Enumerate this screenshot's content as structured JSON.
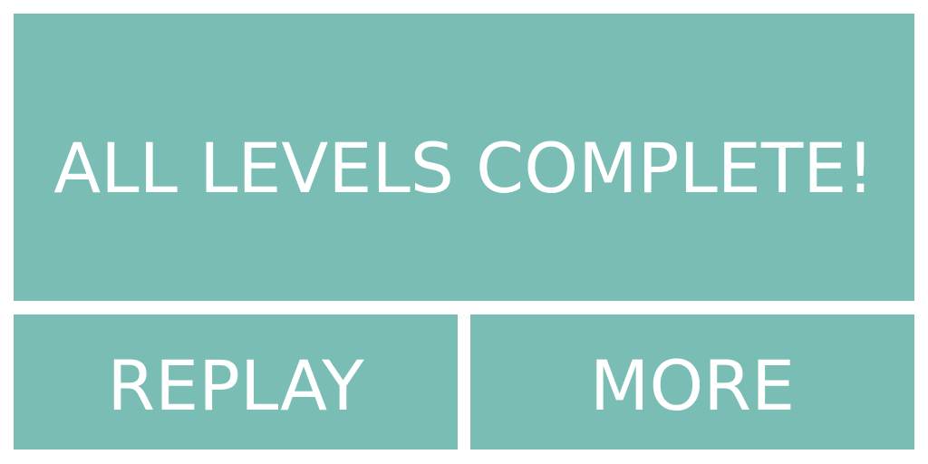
{
  "banner": {
    "title": "ALL LEVELS COMPLETE!"
  },
  "buttons": {
    "replay_label": "REPLAY",
    "more_label": "MORE"
  },
  "colors": {
    "panel": "#79bdb5",
    "text": "#ffffff",
    "background": "#ffffff"
  }
}
